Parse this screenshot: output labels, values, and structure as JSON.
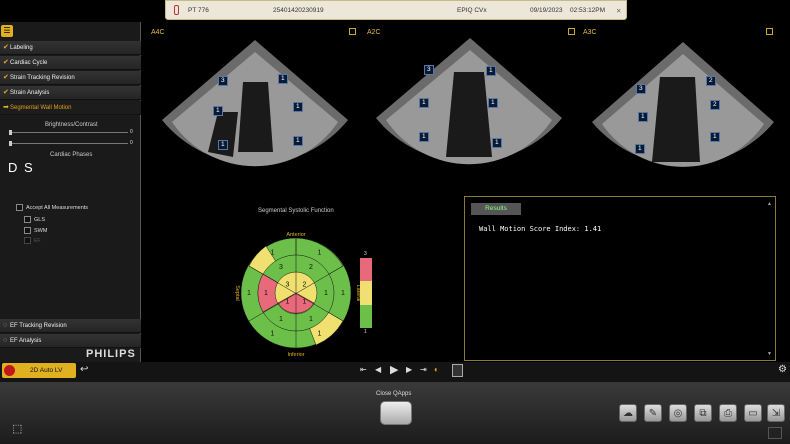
{
  "topbar": {
    "patient": "PT 776",
    "id": "25401420230919",
    "system": "EPIQ CVx",
    "date": "09/19/2023",
    "time": "02:53:12PM"
  },
  "sidebar": {
    "items": [
      {
        "label": "Labeling"
      },
      {
        "label": "Cardiac Cycle"
      },
      {
        "label": "Strain Tracking Revision"
      },
      {
        "label": "Strain Analysis"
      },
      {
        "label": "Segmental Wall Motion"
      }
    ],
    "brightness_label": "Brightness/Contrast",
    "slider1_value": "0",
    "slider2_value": "0",
    "phases_label": "Cardiac Phases",
    "phase_d": "D",
    "phase_s": "S",
    "accept_all": "Accept All Measurements",
    "gls": "GLS",
    "swm": "SWM",
    "ef": "EF",
    "bottom_items": [
      {
        "label": "EF Tracking Revision"
      },
      {
        "label": "EF Analysis"
      }
    ],
    "brand": "PHILIPS",
    "mode_button": "2D Auto LV"
  },
  "views": [
    {
      "label": "A4C",
      "segments": [
        "3",
        "1",
        "1",
        "1",
        "1",
        "1"
      ]
    },
    {
      "label": "A2C",
      "segments": [
        "3",
        "1",
        "1",
        "1",
        "1",
        "1"
      ]
    },
    {
      "label": "A3C",
      "segments": [
        "3",
        "1",
        "1",
        "2",
        "2",
        "1"
      ]
    }
  ],
  "bullseye": {
    "title": "Segmental Systolic Function",
    "anterior": "Anterior",
    "inferior": "Inferior",
    "septal": "Septal",
    "lateral": "Lateral",
    "values": [
      "1",
      "1",
      "1",
      "1",
      "1",
      "1",
      "2",
      "1",
      "1",
      "1",
      "1",
      "3",
      "2",
      "1",
      "1",
      "3",
      "1",
      "1",
      "1",
      "1",
      "1",
      "1",
      "1",
      "1",
      "1",
      "1",
      "1",
      "1",
      "1",
      "1",
      "1",
      "1",
      "1",
      "1",
      "1",
      "1",
      "2",
      "1",
      "1"
    ],
    "scale": [
      "3",
      "2",
      "1"
    ]
  },
  "results": {
    "tab": "Results",
    "text": "Wall Motion Score Index: 1.41"
  },
  "dock": {
    "close_label": "Close QApps"
  },
  "colors": {
    "accent": "#e0b020",
    "normal": "#6cc04a",
    "hypo": "#f0e070",
    "akinetic": "#e86a7a"
  }
}
